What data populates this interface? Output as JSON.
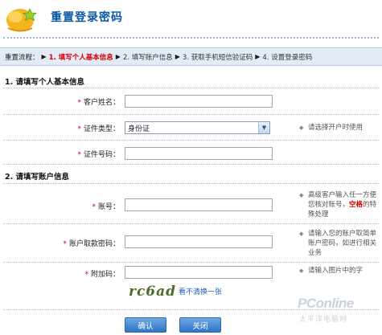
{
  "header": {
    "title": "重置登录密码"
  },
  "steps": {
    "lead": "重置流程：",
    "items": [
      {
        "label": "1. 填写个人基本信息",
        "active": true
      },
      {
        "label": "2. 填写账户信息",
        "active": false
      },
      {
        "label": "3. 获取手机短信验证码",
        "active": false
      },
      {
        "label": "4. 设置登录密码",
        "active": false
      }
    ]
  },
  "section1": {
    "title": "1. 请填写个人基本信息",
    "name_label": "客户姓名：",
    "id_type_label": "证件类型：",
    "id_type_value": "身份证",
    "id_type_hint": "请选择开户时使用",
    "id_number_label": "证件号码："
  },
  "section2": {
    "title": "2. 请填写账户信息",
    "account_label": "账号：",
    "account_hint_a": "高级客户输入任一方便您核对账号，",
    "account_hint_em": "空格",
    "account_hint_b": "的特殊处理",
    "password_label": "账户取款密码：",
    "password_hint": "请输入您的账户取简单账户密码，如进行相关业务",
    "captcha_label": "附加码：",
    "captcha_hint": "请输入图片中的字",
    "captcha_text": "rc6ad",
    "captcha_refresh": "看不清换一张"
  },
  "buttons": {
    "confirm": "确认",
    "close": "关闭"
  },
  "watermark": {
    "brand": "PConline",
    "sub": "太平洋电脑网"
  },
  "colors": {
    "title": "#0a56a6",
    "active_step": "#d40000",
    "required_mark": "#d40000",
    "button": "#2f75c6"
  }
}
